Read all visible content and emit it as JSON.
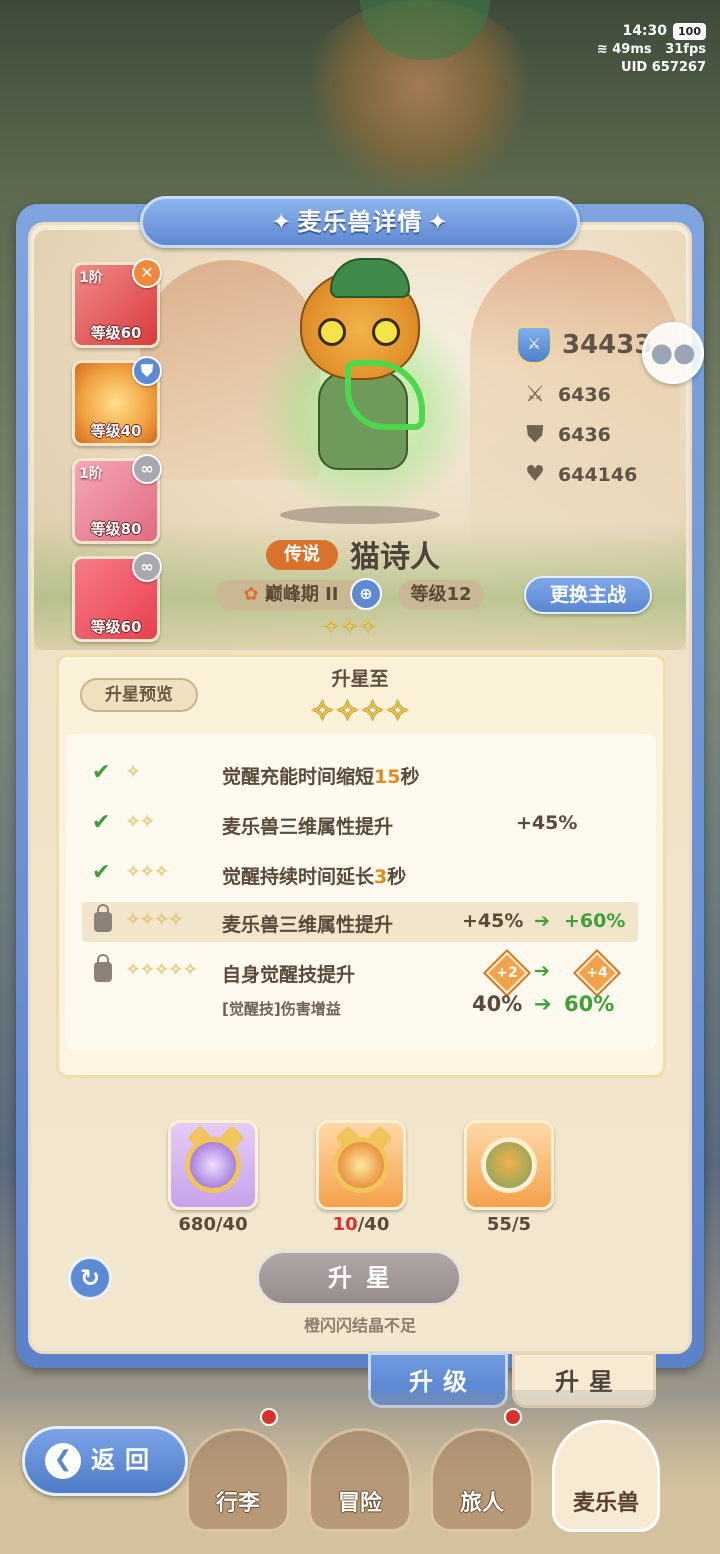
{
  "status": {
    "time": "14:30",
    "battery": "100",
    "ping": "49ms",
    "fps": "31fps",
    "uid": "UID 657267"
  },
  "title": "麦乐兽详情",
  "cards": [
    {
      "tier": "1阶",
      "level": "等级60",
      "badge": "✕",
      "badge_color": "#f08a3a",
      "color": "#e84a4a"
    },
    {
      "tier": "",
      "level": "等级40",
      "badge": "⛊",
      "badge_color": "#5c8ad4",
      "color": "#f0a040"
    },
    {
      "tier": "1阶",
      "level": "等级80",
      "badge": "∞",
      "badge_color": "#a8a8b0",
      "color": "#e86a82"
    },
    {
      "tier": "",
      "level": "等级60",
      "badge": "∞",
      "badge_color": "#a8a8b0",
      "color": "#f05a6a"
    }
  ],
  "stats": {
    "power": "34433",
    "attack": "6436",
    "defense": "6436",
    "hp": "644146"
  },
  "character": {
    "rarity": "传说",
    "name": "猫诗人",
    "stage": "巅峰期 II",
    "level": "等级12",
    "current_stars": "✧✧✧"
  },
  "switch_button": "更换主战",
  "upgrade": {
    "preview_label": "升星预览",
    "target_label": "升星至",
    "target_stars": "✧✧✧✧",
    "rows": [
      {
        "status": "done",
        "stars": "✧",
        "desc_a": "觉醒充能时间缩短",
        "desc_num": "15",
        "desc_b": "秒",
        "value": ""
      },
      {
        "status": "done",
        "stars": "✧✧",
        "desc_a": "麦乐兽三维属性提升",
        "desc_num": "",
        "desc_b": "",
        "value": "+45%"
      },
      {
        "status": "done",
        "stars": "✧✧✧",
        "desc_a": "觉醒持续时间延长",
        "desc_num": "3",
        "desc_b": "秒",
        "value": ""
      },
      {
        "status": "locked",
        "stars": "✧✧✧✧",
        "desc_a": "麦乐兽三维属性提升",
        "from": "+45%",
        "to": "+60%"
      },
      {
        "status": "locked",
        "stars": "✧✧✧✧✧",
        "desc_a": "自身觉醒技提升",
        "from_badge": "+2",
        "to_badge": "+4",
        "sub": "[觉醒技]伤害增益",
        "from": "40%",
        "to": "60%"
      }
    ],
    "arrow": "➔"
  },
  "materials": [
    {
      "have": "680",
      "need": "/40",
      "color": "#c7a2ec"
    },
    {
      "have": "10",
      "need": "/40",
      "color": "#f3a14a",
      "insufficient": true
    },
    {
      "have": "55",
      "need": "/5",
      "color": "#f3a14a"
    }
  ],
  "star_button": "升星",
  "insufficient_text": "橙闪闪结晶不足",
  "tabs": {
    "upgrade": "升级",
    "star": "升星"
  },
  "nav": {
    "back": "返回",
    "items": [
      "行李",
      "冒险",
      "旅人",
      "麦乐兽"
    ]
  },
  "colors": {
    "accent": "#5c8ad4",
    "rarity": "#d9722a",
    "green": "#3ea036"
  }
}
